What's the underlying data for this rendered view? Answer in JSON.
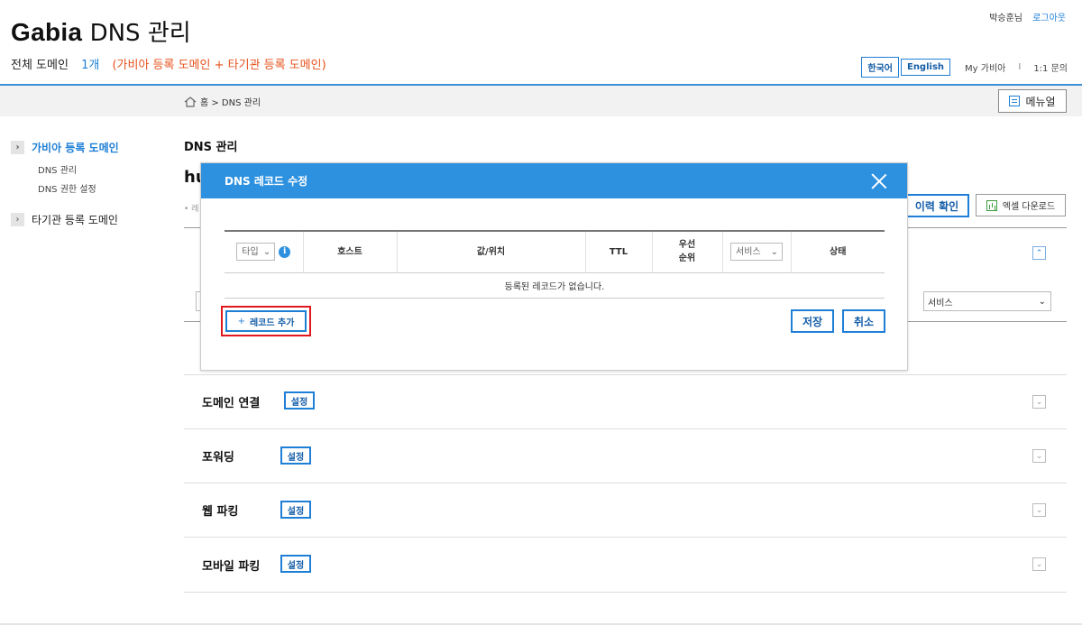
{
  "header": {
    "logo_brand": "Gabia",
    "logo_title": "DNS 관리",
    "user_name": "박승훈님",
    "logout": "로그아웃",
    "summary_label": "전체 도메인",
    "summary_count": "1개",
    "summary_kinds": "(가비아 등록 도메인 + 타기관 등록 도메인)",
    "lang_korean": "한국어",
    "lang_english": "English",
    "my_gabia": "My 가비아",
    "separator": "I",
    "inquiry": "1:1 문의"
  },
  "nav": {
    "breadcrumb": "홈 > DNS 관리",
    "manual": "메뉴얼"
  },
  "sidebar": {
    "arrow_glyph": "›",
    "items": [
      {
        "label": "가비아 등록 도메인",
        "sub": [
          "DNS 관리",
          "DNS 권한 설정"
        ]
      },
      {
        "label": "타기관 등록 도메인"
      }
    ]
  },
  "main": {
    "title": "DNS 관리",
    "domain_partial": "hu",
    "small_mark": "• 레",
    "history_button": "이력 확인",
    "excel_button": "엑셀 다운로드",
    "service_select": "서비스",
    "chevron_glyph": "⌄",
    "chevron_up_glyph": "⌃",
    "sections": [
      {
        "title": "도메인 연결",
        "button": "설정"
      },
      {
        "title": "포워딩",
        "button": "설정"
      },
      {
        "title": "웹 파킹",
        "button": "설정"
      },
      {
        "title": "모바일 파킹",
        "button": "설정"
      }
    ]
  },
  "modal": {
    "title": "DNS 레코드 수정",
    "columns": {
      "type": "타입",
      "info": "i",
      "host": "호스트",
      "value": "값/위치",
      "ttl": "TTL",
      "priority_line1": "우선",
      "priority_line2": "순위",
      "service": "서비스",
      "status": "상태"
    },
    "empty_message": "등록된 레코드가 없습니다.",
    "add_plus": "+",
    "add_button": "레코드 추가",
    "save": "저장",
    "cancel": "취소"
  },
  "colors": {
    "accent": "#1f7fd6",
    "modal_header": "#2d91e0",
    "orange_text": "#e6531d",
    "highlight_box": "#e0191e"
  }
}
